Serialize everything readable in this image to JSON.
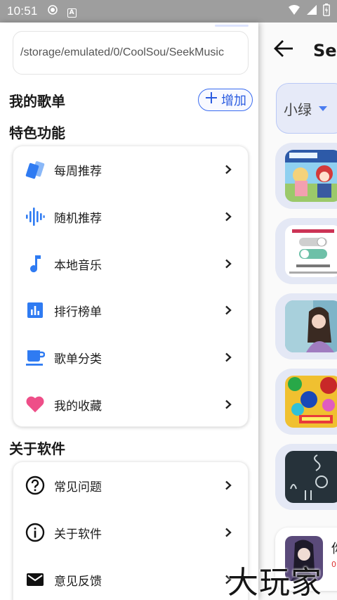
{
  "status_bar": {
    "time": "10:51",
    "icons": [
      "target-icon",
      "a-icon",
      "wifi-icon",
      "signal-icon",
      "battery-icon"
    ]
  },
  "drawer": {
    "storage_path": "/storage/emulated/0/CoolSou/SeekMusic",
    "my_playlists": {
      "title": "我的歌单",
      "add_label": "增加"
    },
    "features": {
      "title": "特色功能",
      "items": [
        {
          "label": "每周推荐",
          "icon": "cards-icon"
        },
        {
          "label": "随机推荐",
          "icon": "waveform-icon"
        },
        {
          "label": "本地音乐",
          "icon": "music-note-icon"
        },
        {
          "label": "排行榜单",
          "icon": "bar-chart-icon"
        },
        {
          "label": "歌单分类",
          "icon": "coffee-cup-icon"
        },
        {
          "label": "我的收藏",
          "icon": "heart-icon"
        }
      ]
    },
    "about": {
      "title": "关于软件",
      "items": [
        {
          "label": "常见问题",
          "icon": "help-circle-icon"
        },
        {
          "label": "关于软件",
          "icon": "info-circle-icon"
        },
        {
          "label": "意见反馈",
          "icon": "mail-icon"
        }
      ]
    }
  },
  "background_page": {
    "title": "Seek",
    "source_select": "小绿",
    "list_row_text": "你",
    "list_row_sub": "0",
    "cover_names": [
      "anime-cover",
      "switch-off-cover",
      "portrait-cover",
      "game-cover",
      "dark-text-cover"
    ]
  },
  "watermark": "大玩家",
  "colors": {
    "accent_blue": "#2f7bf2",
    "heart_pink": "#ee4e88",
    "status_bar": "#9e9e9e"
  }
}
